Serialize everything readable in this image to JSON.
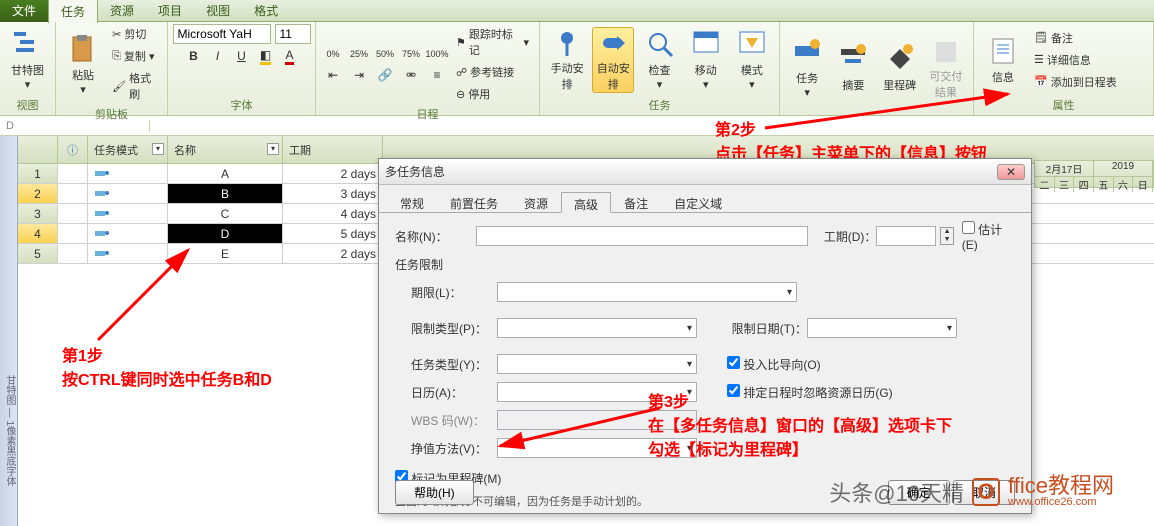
{
  "tabs": {
    "file": "文件",
    "task": "任务",
    "resource": "资源",
    "project": "项目",
    "view": "视图",
    "format": "格式"
  },
  "ribbon": {
    "view_group": "视图",
    "clipboard_group": "剪贴板",
    "font_group": "字体",
    "schedule_group": "日程",
    "tasks_group": "任务",
    "insert_group": "",
    "properties_group": "属性",
    "gantt": "甘特图",
    "paste": "粘贴",
    "cut": "剪切",
    "copy": "复制",
    "format_painter": "格式刷",
    "font_name": "Microsoft YaH",
    "font_size": "11",
    "bold": "B",
    "italic": "I",
    "underline": "U",
    "track_label": "跟踪时标记",
    "reference_link": "参考链接",
    "disable": "停用",
    "manual": "手动安排",
    "auto": "自动安排",
    "inspect": "检查",
    "move": "移动",
    "mode": "模式",
    "task_btn": "任务",
    "summary": "摘要",
    "milestone": "里程碑",
    "deliverable": "可交付结果",
    "info": "信息",
    "notes": "备注",
    "details": "详细信息",
    "add_timeline": "添加到日程表"
  },
  "formula_cell": "D",
  "grid": {
    "headers": {
      "info": "ⓘ",
      "mode": "任务模式",
      "name": "名称",
      "duration": "工期"
    },
    "rows": [
      {
        "num": "1",
        "name": "A",
        "duration": "2 days",
        "sel": false
      },
      {
        "num": "2",
        "name": "B",
        "duration": "3 days",
        "sel": true
      },
      {
        "num": "3",
        "name": "C",
        "duration": "4 days",
        "sel": false
      },
      {
        "num": "4",
        "name": "D",
        "duration": "5 days",
        "sel": true
      },
      {
        "num": "5",
        "name": "E",
        "duration": "2 days",
        "sel": false
      }
    ]
  },
  "left_strip": "甘特图 — 1像素黑底字体",
  "timeline": {
    "week1": "2月17日",
    "week2": "2019",
    "days": [
      "二",
      "三",
      "四",
      "五",
      "六",
      "日"
    ]
  },
  "dialog": {
    "title": "多任务信息",
    "tabs": {
      "general": "常规",
      "predecessor": "前置任务",
      "resource": "资源",
      "advanced": "高级",
      "notes": "备注",
      "custom": "自定义域"
    },
    "name_label": "名称(N)：",
    "duration_label": "工期(D)：",
    "estimate": "估计(E)",
    "constraint_section": "任务限制",
    "deadline_label": "期限(L)：",
    "constraint_type": "限制类型(P)：",
    "constraint_date": "限制日期(T)：",
    "task_type": "任务类型(Y)：",
    "effort_driven": "投入比导向(O)",
    "calendar": "日历(A)：",
    "ignore_cal": "排定日程时忽略资源日历(G)",
    "wbs": "WBS 码(W)：",
    "ev_method": "挣值方法(V)：",
    "mark_milestone": "标记为里程碑(M)",
    "note": "上面的域有部分不可编辑，因为任务是手动计划的。",
    "help": "帮助(H)",
    "ok": "确定",
    "cancel": "取消"
  },
  "annotations": {
    "step1_title": "第1步",
    "step1_text": "按CTRL键同时选中任务B和D",
    "step2_title": "第2步",
    "step2_text": "点击【任务】主菜单下的【信息】按钮",
    "step3_title": "第3步",
    "step3_text1": "在【多任务信息】窗口的【高级】选项卡下",
    "step3_text2": "勾选【标记为里程碑】"
  },
  "watermark": {
    "text1": "头条@10天精",
    "text2": "ffice教程网",
    "url": "www.office26.com"
  }
}
